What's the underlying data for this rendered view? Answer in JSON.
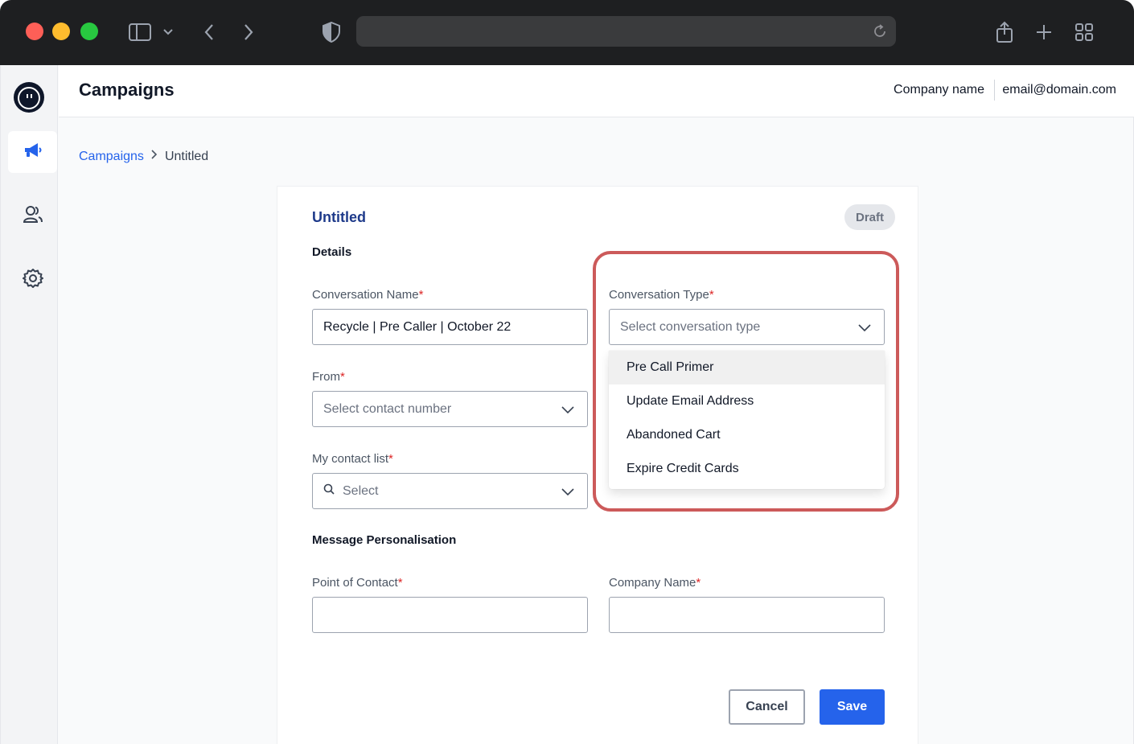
{
  "header": {
    "title": "Campaigns",
    "company": "Company name",
    "email": "email@domain.com"
  },
  "breadcrumb": {
    "root": "Campaigns",
    "current": "Untitled"
  },
  "card": {
    "title": "Untitled",
    "status": "Draft"
  },
  "details": {
    "section_title": "Details",
    "conversation_name": {
      "label": "Conversation Name",
      "required": "*",
      "value": "Recycle | Pre Caller | October 22"
    },
    "from": {
      "label": "From",
      "required": "*",
      "placeholder": "Select contact number"
    },
    "contact_list": {
      "label": "My contact list",
      "required": "*",
      "placeholder": "Select"
    },
    "conversation_type": {
      "label": "Conversation Type",
      "required": "*",
      "placeholder": "Select conversation type",
      "options": [
        "Pre Call Primer",
        "Update Email Address",
        "Abandoned Cart",
        "Expire Credit Cards"
      ]
    }
  },
  "personalisation": {
    "section_title": "Message Personalisation",
    "point_of_contact": {
      "label": "Point of Contact",
      "required": "*",
      "value": ""
    },
    "company_name": {
      "label": "Company Name",
      "required": "*",
      "value": ""
    }
  },
  "actions": {
    "cancel": "Cancel",
    "save": "Save"
  },
  "icons": {
    "sidebar": [
      "logo-icon",
      "megaphone-icon",
      "users-icon",
      "gear-icon"
    ],
    "chrome": [
      "sidebar-toggle-icon",
      "chevron-down-icon",
      "back-icon",
      "forward-icon",
      "shield-icon",
      "reload-icon",
      "share-icon",
      "plus-icon",
      "tabs-grid-icon"
    ]
  },
  "colors": {
    "accent": "#2563eb",
    "title": "#1e3a8a",
    "highlight": "#cc5a5a",
    "required": "#dc2626"
  }
}
